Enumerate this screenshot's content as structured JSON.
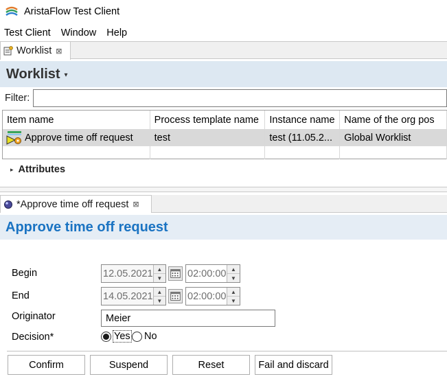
{
  "window": {
    "title": "AristaFlow Test Client",
    "app_icon": "aristaflow-logo-icon"
  },
  "menubar": {
    "items": [
      "Test Client",
      "Window",
      "Help"
    ]
  },
  "worklist_tab": {
    "label": "Worklist",
    "icon": "worklist-icon",
    "close": "⊠"
  },
  "worklist_header": {
    "title": "Worklist",
    "menu_chevron": "▾"
  },
  "filter": {
    "label": "Filter:",
    "value": ""
  },
  "table": {
    "columns": [
      "Item name",
      "Process template name",
      "Instance name",
      "Name of the org pos"
    ],
    "rows": [
      {
        "item_name": "Approve time off request",
        "process_template": "test",
        "instance_name": "test (11.05.2...",
        "org_pos": "Global Worklist",
        "icon": "work-item-icon",
        "selected": true
      }
    ]
  },
  "attributes": {
    "label": "Attributes",
    "expander": "▸"
  },
  "editor_tab": {
    "label": "*Approve time off request",
    "icon": "form-icon",
    "close": "⊠"
  },
  "form": {
    "title": "Approve time off request",
    "begin": {
      "label": "Begin",
      "date": "12.05.2021",
      "time": "02:00:00"
    },
    "end": {
      "label": "End",
      "date": "14.05.2021",
      "time": "02:00:00"
    },
    "originator": {
      "label": "Originator",
      "value": "Meier"
    },
    "decision": {
      "label": "Decision*",
      "options": [
        "Yes",
        "No"
      ],
      "selected": "Yes"
    }
  },
  "spinner": {
    "up": "▲",
    "down": "▼"
  },
  "buttons": {
    "confirm": "Confirm",
    "suspend": "Suspend",
    "reset": "Reset",
    "fail": "Fail and discard"
  }
}
